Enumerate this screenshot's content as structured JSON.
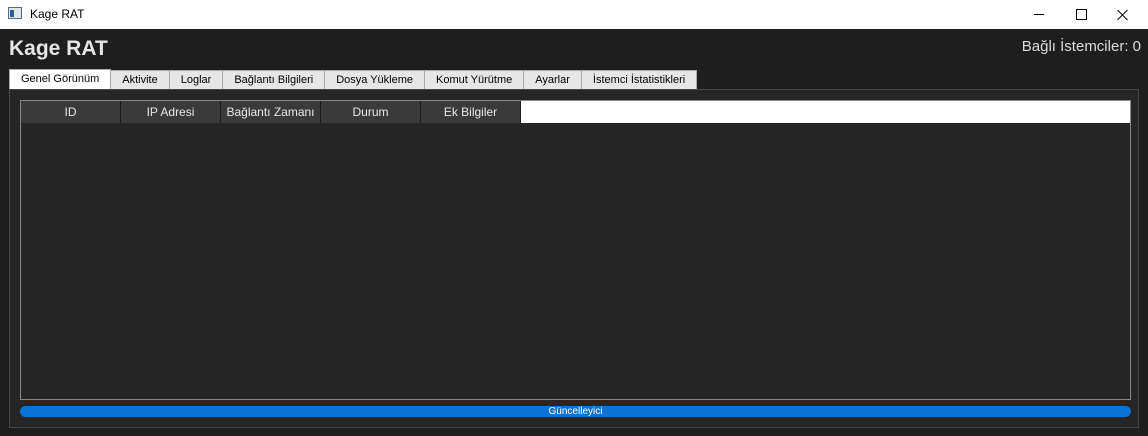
{
  "window": {
    "title": "Kage RAT"
  },
  "header": {
    "app_title": "Kage RAT",
    "client_count_label": "Bağlı İstemciler: 0"
  },
  "tabs": [
    {
      "label": "Genel Görünüm",
      "active": true
    },
    {
      "label": "Aktivite",
      "active": false
    },
    {
      "label": "Loglar",
      "active": false
    },
    {
      "label": "Bağlantı Bilgileri",
      "active": false
    },
    {
      "label": "Dosya Yükleme",
      "active": false
    },
    {
      "label": "Komut Yürütme",
      "active": false
    },
    {
      "label": "Ayarlar",
      "active": false
    },
    {
      "label": "İstemci İstatistikleri",
      "active": false
    }
  ],
  "table": {
    "columns": [
      "ID",
      "IP Adresi",
      "Bağlantı Zamanı",
      "Durum",
      "Ek Bilgiler"
    ],
    "rows": []
  },
  "updater": {
    "label": "Güncelleyici",
    "progress_percent": 100
  },
  "colors": {
    "accent": "#0a74d6",
    "background": "#1e1e1e"
  },
  "icons": {
    "app": "app-window-icon",
    "minimize": "minimize-icon",
    "maximize": "maximize-icon",
    "close": "close-icon"
  }
}
